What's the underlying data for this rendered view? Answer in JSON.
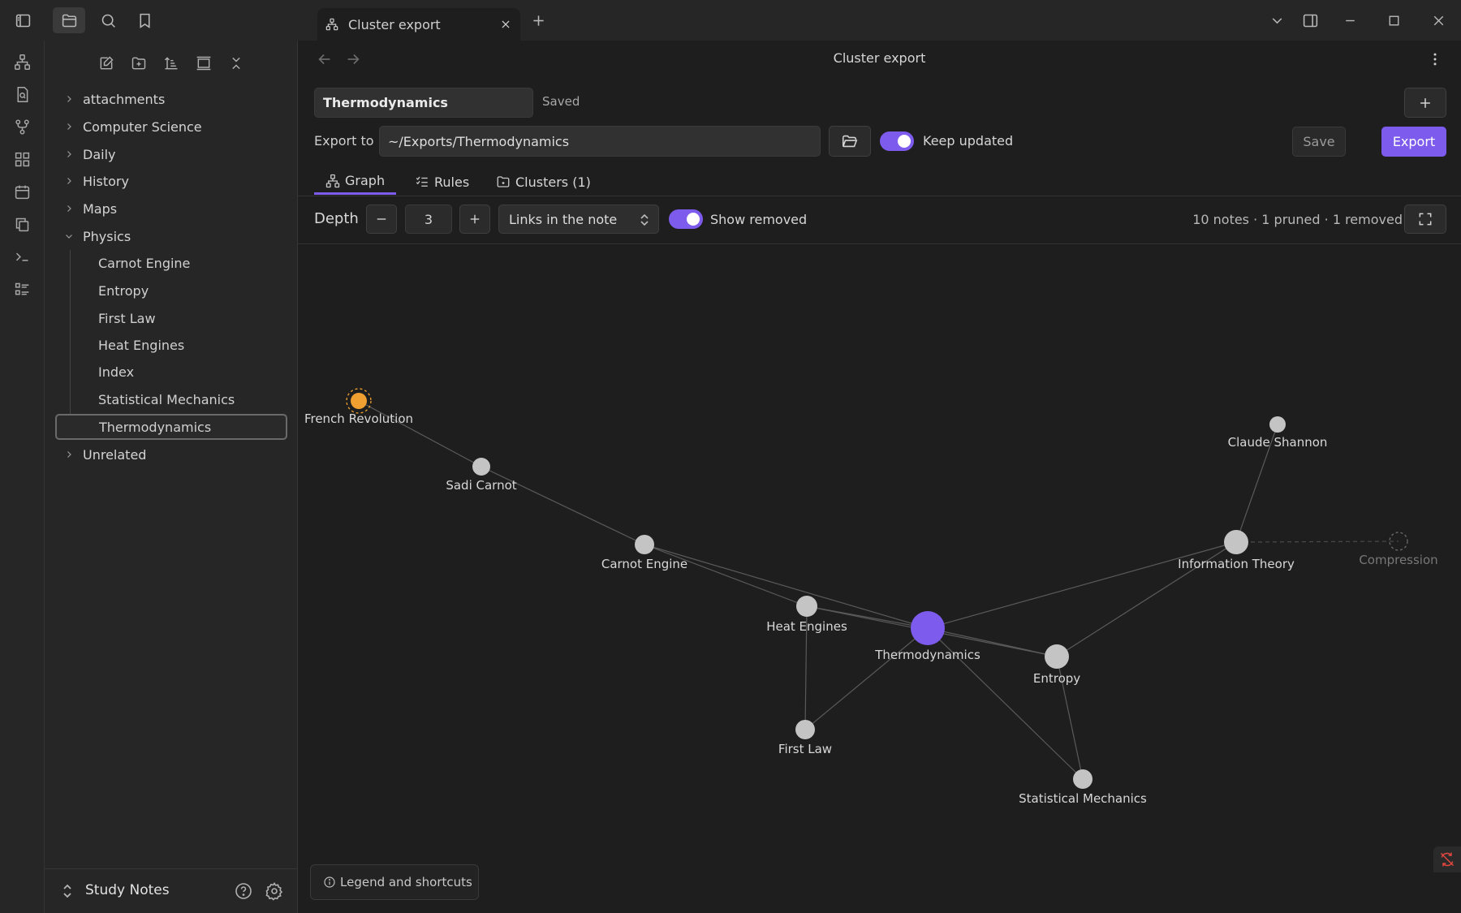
{
  "titlebar": {
    "tab_title": "Cluster export",
    "icons": [
      "sidebar-toggle-icon",
      "folder-icon",
      "search-icon",
      "bookmark-icon",
      "chevron-down-icon",
      "right-sidebar-icon",
      "minimize-icon",
      "maximize-icon",
      "close-icon"
    ]
  },
  "ribbon": {
    "icons": [
      "graph-icon",
      "search-file-icon",
      "branch-icon",
      "grid-icon",
      "calendar-icon",
      "copy-icon",
      "terminal-icon",
      "list-icon"
    ]
  },
  "sidebar": {
    "tools": [
      "new-note-icon",
      "new-folder-icon",
      "sort-icon",
      "collapse-panel-icon",
      "collapse-all-icon"
    ],
    "tree": [
      {
        "label": "attachments",
        "expanded": false
      },
      {
        "label": "Computer Science",
        "expanded": false
      },
      {
        "label": "Daily",
        "expanded": false
      },
      {
        "label": "History",
        "expanded": false
      },
      {
        "label": "Maps",
        "expanded": false
      },
      {
        "label": "Physics",
        "expanded": true,
        "children": [
          "Carnot Engine",
          "Entropy",
          "First Law",
          "Heat Engines",
          "Index",
          "Statistical Mechanics",
          "Thermodynamics"
        ],
        "selected": "Thermodynamics"
      },
      {
        "label": "Unrelated",
        "expanded": false
      }
    ],
    "vault_name": "Study Notes"
  },
  "view": {
    "title": "Cluster export",
    "cluster_name": "Thermodynamics",
    "saved_status": "Saved",
    "export_to_label": "Export to",
    "export_path": "~/Exports/Thermodynamics",
    "keep_updated_label": "Keep updated",
    "keep_updated": true,
    "save_label": "Save",
    "export_label": "Export",
    "tabs": [
      {
        "label": "Graph",
        "active": true
      },
      {
        "label": "Rules",
        "active": false
      },
      {
        "label": "Clusters (1)",
        "active": false
      }
    ],
    "depth_label": "Depth",
    "depth_value": "3",
    "link_mode": "Links in the note",
    "show_removed_label": "Show removed",
    "show_removed": true,
    "stats": "10 notes · 1 pruned · 1 removed",
    "legend_label": "Legend and shortcuts"
  },
  "colors": {
    "accent": "#7d5bed",
    "node": "#c4c4c4",
    "pruned_node": "#f0a030",
    "removed_node": "#666666"
  },
  "graph": {
    "nodes": [
      {
        "id": "french-revolution",
        "label": "French Revolution",
        "status": "pruned"
      },
      {
        "id": "sadi-carnot",
        "label": "Sadi Carnot",
        "status": "normal"
      },
      {
        "id": "carnot-engine",
        "label": "Carnot Engine",
        "status": "normal"
      },
      {
        "id": "heat-engines",
        "label": "Heat Engines",
        "status": "normal"
      },
      {
        "id": "thermodynamics",
        "label": "Thermodynamics",
        "status": "root"
      },
      {
        "id": "entropy",
        "label": "Entropy",
        "status": "normal"
      },
      {
        "id": "first-law",
        "label": "First Law",
        "status": "normal"
      },
      {
        "id": "statistical-mechanics",
        "label": "Statistical Mechanics",
        "status": "normal"
      },
      {
        "id": "information-theory",
        "label": "Information Theory",
        "status": "normal"
      },
      {
        "id": "claude-shannon",
        "label": "Claude Shannon",
        "status": "normal"
      },
      {
        "id": "compression",
        "label": "Compression",
        "status": "removed"
      }
    ],
    "edges": [
      [
        "french-revolution",
        "sadi-carnot"
      ],
      [
        "sadi-carnot",
        "carnot-engine"
      ],
      [
        "carnot-engine",
        "heat-engines"
      ],
      [
        "carnot-engine",
        "thermodynamics"
      ],
      [
        "heat-engines",
        "thermodynamics"
      ],
      [
        "heat-engines",
        "entropy"
      ],
      [
        "heat-engines",
        "first-law"
      ],
      [
        "thermodynamics",
        "first-law"
      ],
      [
        "thermodynamics",
        "entropy"
      ],
      [
        "thermodynamics",
        "statistical-mechanics"
      ],
      [
        "thermodynamics",
        "information-theory"
      ],
      [
        "entropy",
        "information-theory"
      ],
      [
        "entropy",
        "statistical-mechanics"
      ],
      [
        "information-theory",
        "claude-shannon"
      ],
      [
        "information-theory",
        "compression"
      ]
    ]
  }
}
